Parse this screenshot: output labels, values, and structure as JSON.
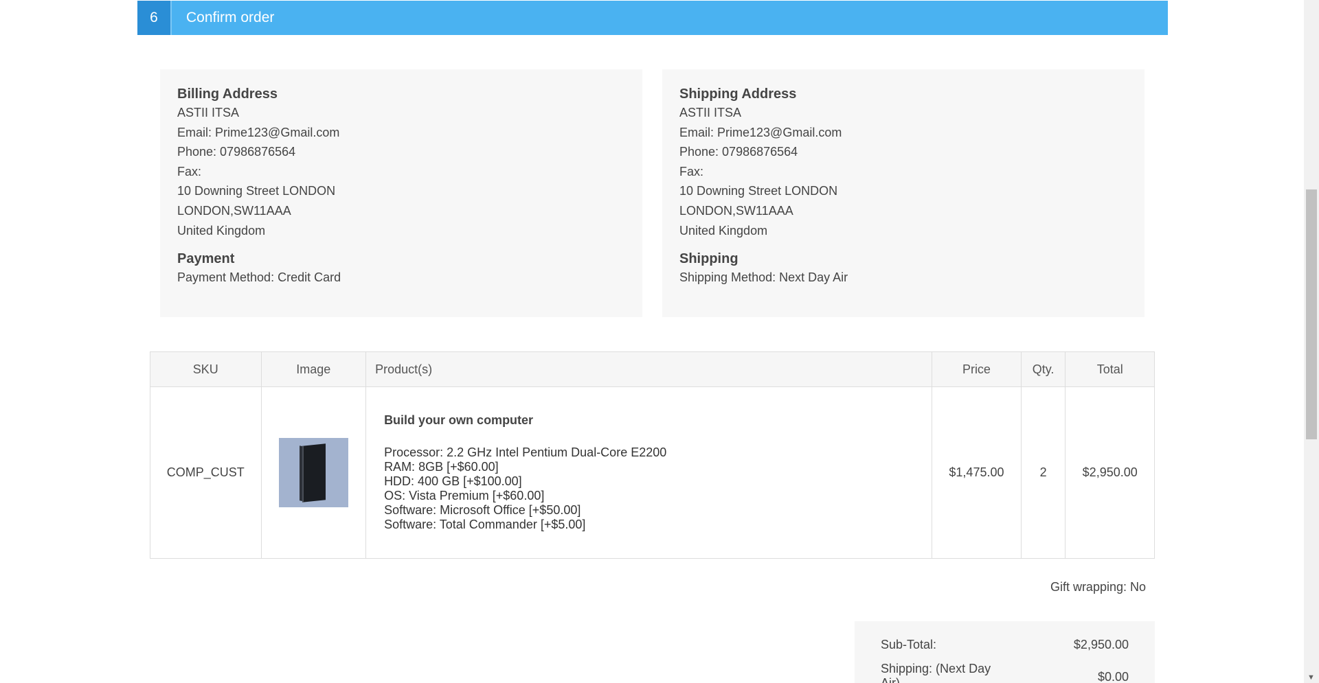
{
  "step": {
    "number": "6",
    "title": "Confirm order"
  },
  "billing": {
    "heading": "Billing Address",
    "name": "ASTII ITSA",
    "email": "Email: Prime123@Gmail.com",
    "phone": "Phone: 07986876564",
    "fax": "Fax:",
    "street": "10 Downing Street LONDON",
    "city": "LONDON,SW11AAA",
    "country": "United Kingdom"
  },
  "payment": {
    "heading": "Payment",
    "method": "Payment Method: Credit Card"
  },
  "shipping_address": {
    "heading": "Shipping Address",
    "name": "ASTII ITSA",
    "email": "Email: Prime123@Gmail.com",
    "phone": "Phone: 07986876564",
    "fax": "Fax:",
    "street": "10 Downing Street LONDON",
    "city": "LONDON,SW11AAA",
    "country": "United Kingdom"
  },
  "shipping": {
    "heading": "Shipping",
    "method": "Shipping Method: Next Day Air"
  },
  "cart": {
    "headers": {
      "sku": "SKU",
      "image": "Image",
      "products": "Product(s)",
      "price": "Price",
      "qty": "Qty.",
      "total": "Total"
    },
    "items": [
      {
        "sku": "COMP_CUST",
        "image_icon": "computer-tower-image",
        "name": "Build your own computer",
        "attributes": [
          "Processor: 2.2 GHz Intel Pentium Dual-Core E2200",
          "RAM: 8GB [+$60.00]",
          "HDD: 400 GB [+$100.00]",
          "OS: Vista Premium [+$60.00]",
          "Software: Microsoft Office [+$50.00]",
          "Software: Total Commander [+$5.00]"
        ],
        "price": "$1,475.00",
        "qty": "2",
        "total": "$2,950.00"
      }
    ]
  },
  "gift_wrapping": "Gift wrapping: No",
  "totals": {
    "subtotal_label": "Sub-Total:",
    "subtotal_value": "$2,950.00",
    "shipping_label_1": "Shipping: (Next Day",
    "shipping_label_2": "Air)",
    "shipping_value": "$0.00"
  },
  "scrollbar": {
    "down_icon": "scroll-down-arrow-icon"
  }
}
